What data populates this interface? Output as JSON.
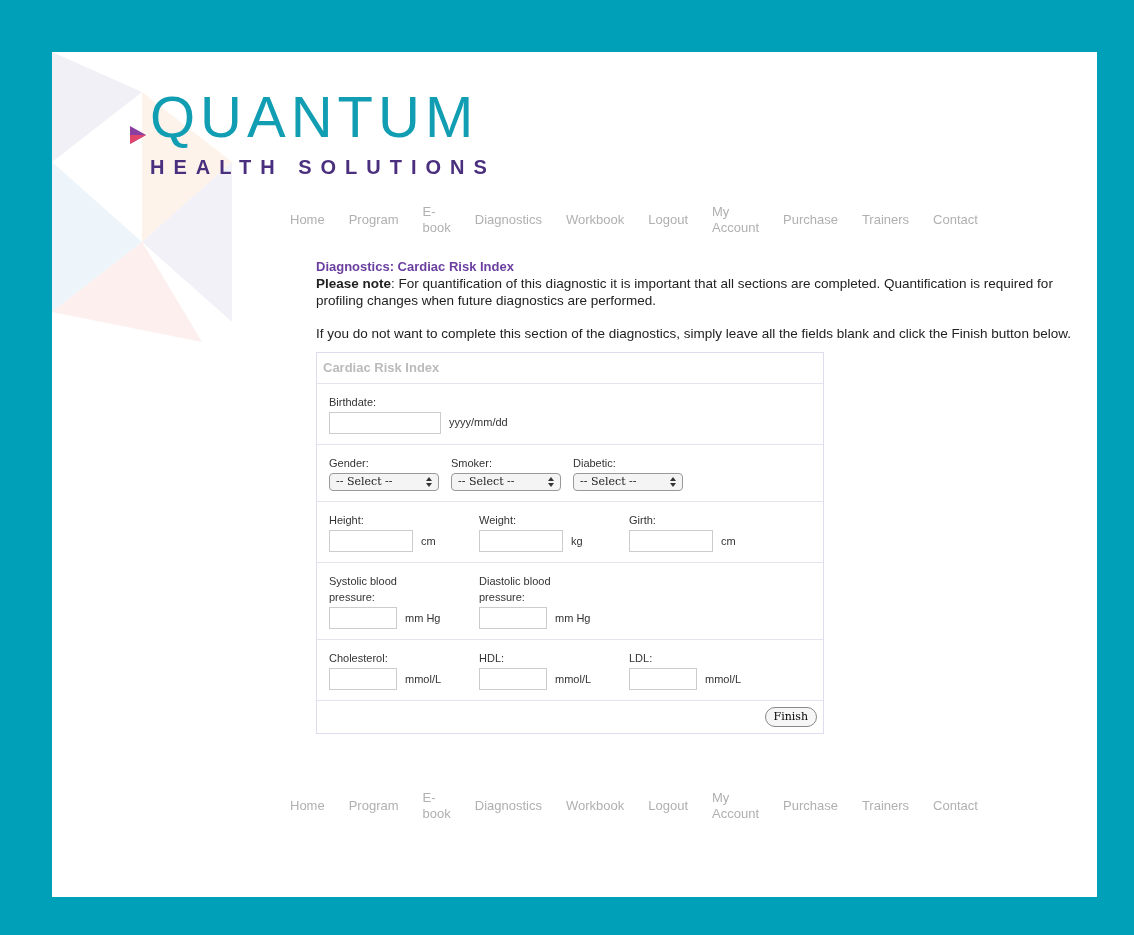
{
  "logo": {
    "word": "QUANTUM",
    "tagline": "HEALTH SOLUTIONS"
  },
  "nav_top": [
    "Home",
    "Program",
    "E-book",
    "Diagnostics",
    "Workbook",
    "Logout",
    "My Account",
    "Purchase",
    "Trainers",
    "Contact"
  ],
  "intro": {
    "title": "Diagnostics: Cardiac Risk Index",
    "note": "**Please note**: For quantification of this diagnostic it is important that all sections are completed. Quantification is required for profiling changes when future diagnostics are performed.",
    "instructions": "If you do not want to complete this section of the diagnostics, simply leave all the fields blank and click the Finish button below."
  },
  "form": {
    "title": "Cardiac Risk Index",
    "sections": [
      {
        "fields": [
          {
            "kind": "input",
            "label": "Birthdate:",
            "unit": "yyyy/mm/dd"
          }
        ]
      },
      {
        "fields": [
          {
            "kind": "select",
            "label": "Gender:",
            "value": "-- Select --"
          },
          {
            "kind": "select",
            "label": "Smoker:",
            "value": "-- Select --"
          },
          {
            "kind": "select",
            "label": "Diabetic:",
            "value": "-- Select --"
          }
        ]
      },
      {
        "fields": [
          {
            "kind": "input",
            "label": "Height:",
            "unit": "cm"
          },
          {
            "kind": "input",
            "label": "Weight:",
            "unit": "kg"
          },
          {
            "kind": "input",
            "label": "Girth:",
            "unit": "cm"
          }
        ]
      },
      {
        "fields": [
          {
            "kind": "input",
            "label": "Systolic blood pressure:",
            "unit": "mm Hg"
          },
          {
            "kind": "input",
            "label": "Diastolic blood pressure:",
            "unit": "mm Hg"
          }
        ]
      },
      {
        "fields": [
          {
            "kind": "input",
            "label": "Cholesterol:",
            "unit": "mmol/L"
          },
          {
            "kind": "input",
            "label": "HDL:",
            "unit": "mmol/L"
          },
          {
            "kind": "input",
            "label": "LDL:",
            "unit": "mmol/L"
          }
        ]
      }
    ],
    "button": "Finish"
  },
  "nav_bottom": [
    "Home",
    "Program",
    "E-book",
    "Diagnostics",
    "Workbook",
    "Logout",
    "My Account",
    "Purchase",
    "Trainers",
    "Contact"
  ]
}
